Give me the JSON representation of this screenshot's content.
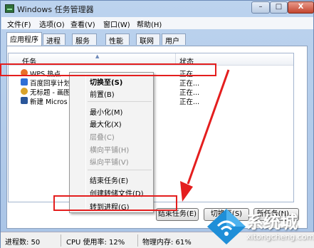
{
  "window": {
    "title": "Windows 任务管理器",
    "controls": {
      "minimize": "–",
      "maximize": "□",
      "close": "X"
    }
  },
  "menubar": [
    "文件(F)",
    "选项(O)",
    "查看(V)",
    "窗口(W)",
    "帮助(H)"
  ],
  "tabs": [
    "应用程序",
    "进程",
    "服务",
    "性能",
    "联网",
    "用户"
  ],
  "list": {
    "columns": {
      "task": "任务",
      "status": "状态"
    },
    "rows": [
      {
        "name": "WPS 热点",
        "status": "正在...",
        "icon": "wps-hotspot-icon",
        "icon_color": "#e8702a"
      },
      {
        "name": "百度回享计划",
        "status": "正在...",
        "icon": "baidu-icon",
        "icon_color": "#2f6fd6"
      },
      {
        "name": "无标题 - 画图",
        "status": "正在...",
        "icon": "paint-icon",
        "icon_color": "#d9a32b"
      },
      {
        "name": "新建 Micros",
        "status": "正在...",
        "icon": "word-icon",
        "icon_color": "#2a5699"
      }
    ]
  },
  "buttons": {
    "end_task": "结束任务(E)",
    "switch_to": "切换至(S)",
    "new_task": "新任务(N)..."
  },
  "statusbar": {
    "processes": "进程数: 50",
    "cpu": "CPU 使用率: 12%",
    "memory": "物理内存: 61%"
  },
  "context_menu": {
    "items": [
      {
        "label": "切换至(S)",
        "style": "bold"
      },
      {
        "label": "前置(B)",
        "style": "normal"
      },
      {
        "label": "最小化(M)",
        "style": "normal"
      },
      {
        "label": "最大化(X)",
        "style": "normal"
      },
      {
        "label": "层叠(C)",
        "style": "disabled"
      },
      {
        "label": "横向平铺(H)",
        "style": "disabled"
      },
      {
        "label": "纵向平铺(V)",
        "style": "disabled"
      },
      {
        "label": "结束任务(E)",
        "style": "normal"
      },
      {
        "label": "创建转储文件(D)",
        "style": "normal"
      },
      {
        "label": "转到进程(G)",
        "style": "normal"
      }
    ]
  },
  "annotation": {
    "highlight_color": "#e41e1e"
  },
  "watermark": {
    "text": "系统城",
    "subtext": "xitongcheng.com",
    "icon": "wifi-diamond-logo-icon"
  }
}
